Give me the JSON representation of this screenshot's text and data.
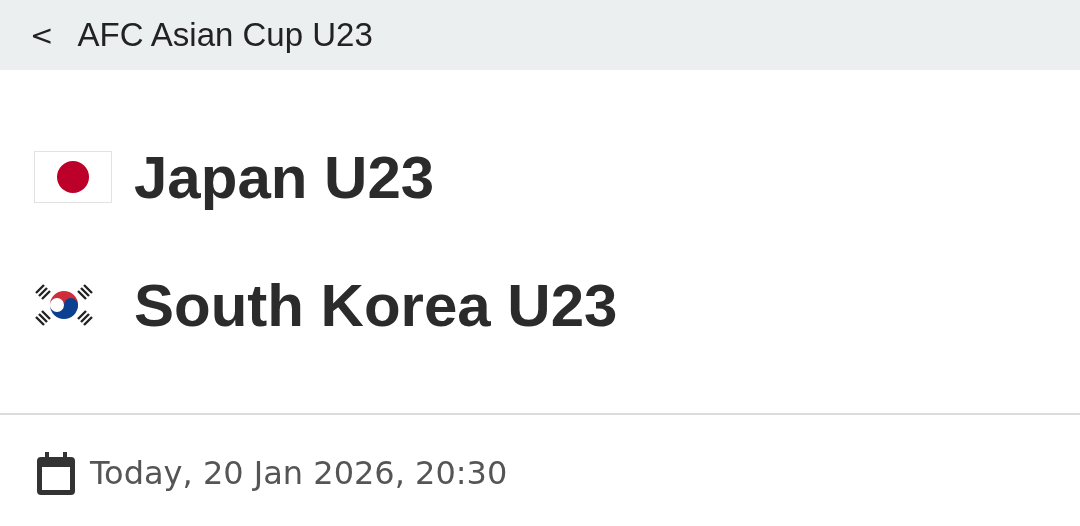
{
  "header": {
    "back": "<",
    "title": "AFC Asian Cup U23"
  },
  "teams": [
    {
      "name": "Japan U23",
      "kind": "japan"
    },
    {
      "name": "South Korea U23",
      "kind": "korea"
    }
  ],
  "date": "Today, 20 Jan 2026, 20:30"
}
